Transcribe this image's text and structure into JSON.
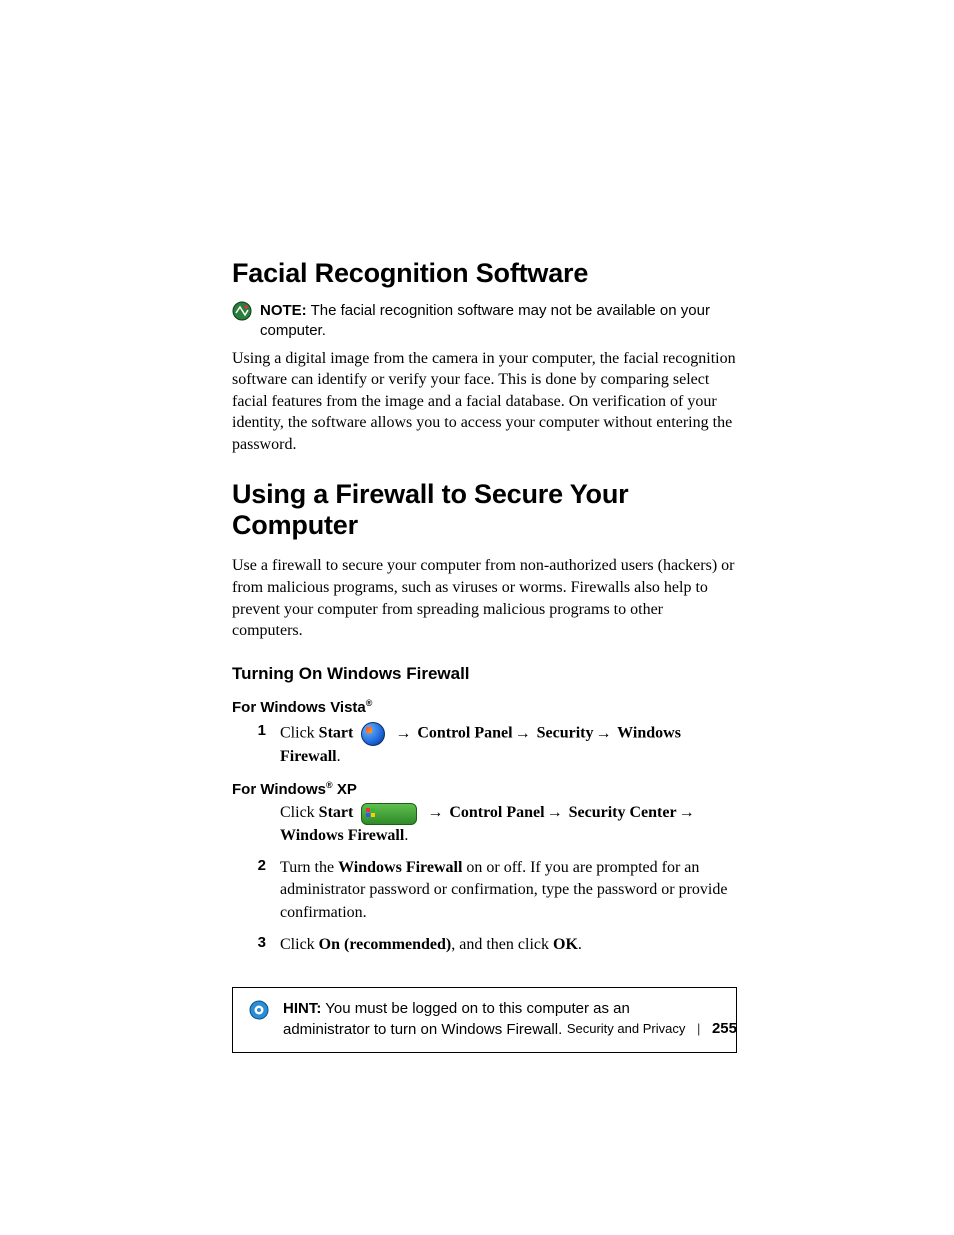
{
  "section1": {
    "heading": "Facial Recognition Software",
    "note_label": "NOTE:",
    "note_text": " The facial recognition software may not be available on your computer.",
    "body": "Using a digital image from the camera in your computer, the facial recognition software can identify or verify your face. This is done by comparing select facial features from the image and a facial database. On verification of your identity, the software allows you to access your computer without entering the password."
  },
  "section2": {
    "heading": "Using a Firewall to Secure Your Computer",
    "body": "Use a firewall to secure your computer from non-authorized users (hackers) or from malicious programs, such as viruses or worms. Firewalls also help to prevent your computer from spreading malicious programs to other computers.",
    "subheading": "Turning On Windows Firewall",
    "vista_heading_pre": "For Windows Vista",
    "reg": "®",
    "xp_heading_pre": "For Windows",
    "xp_heading_post": " XP",
    "step1": {
      "num": "1",
      "click": "Click ",
      "start": "Start",
      "arrow": "→",
      "panel": " Control Panel",
      "security": " Security",
      "security_center": " Security Center",
      "fw": " Windows Firewall",
      "period": "."
    },
    "step2": {
      "num": "2",
      "pre": "Turn the ",
      "fw": "Windows Firewall",
      "post": " on or off. If you are prompted for an administrator password or confirmation, type the password or provide confirmation."
    },
    "step3": {
      "num": "3",
      "pre": "Click ",
      "rec": "On (recommended)",
      "mid": ", and then click ",
      "ok": "OK",
      "period": "."
    },
    "hint_label": "HINT:",
    "hint_text": " You must be logged on to this computer as an administrator to turn on Windows Firewall."
  },
  "footer": {
    "chapter": "Security and Privacy",
    "sep": "|",
    "page": "255"
  }
}
